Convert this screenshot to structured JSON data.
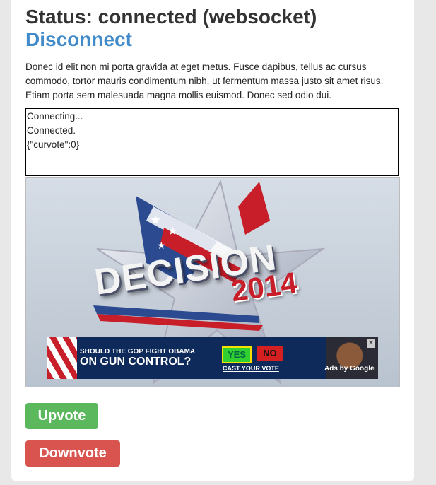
{
  "header": {
    "status": "Status: connected (websocket)",
    "disconnect_label": "Disconnect"
  },
  "body_text": "Donec id elit non mi porta gravida at eget metus. Fusce dapibus, tellus ac cursus commodo, tortor mauris condimentum nibh, ut fermentum massa justo sit amet risus. Etiam porta sem malesuada magna mollis euismod. Donec sed odio dui.",
  "log": {
    "lines": [
      "Connecting...",
      "Connected.",
      "{\"curvote\":0}"
    ]
  },
  "video": {
    "title_word": "DECISION",
    "year": "2014",
    "ad": {
      "question_line1": "SHOULD THE GOP FIGHT OBAMA",
      "question_line2": "ON GUN CONTROL?",
      "yes_label": "YES",
      "no_label": "NO",
      "cast_label": "CAST YOUR VOTE",
      "ads_by": "Ads by Google",
      "close_glyph": "✕"
    }
  },
  "buttons": {
    "upvote": "Upvote",
    "downvote": "Downvote"
  },
  "colors": {
    "link": "#428bca",
    "upvote": "#5cb85c",
    "downvote": "#d9534f"
  }
}
